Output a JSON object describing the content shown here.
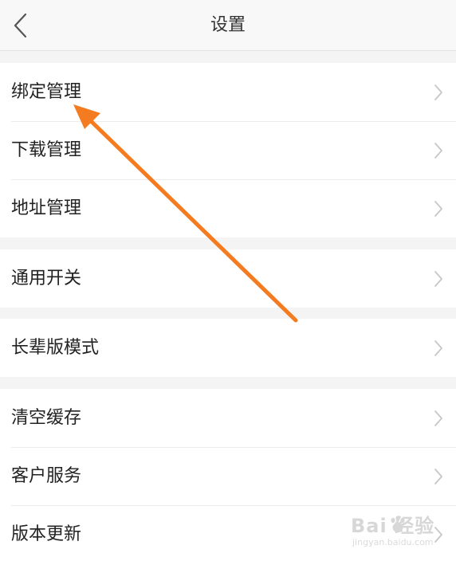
{
  "header": {
    "title": "设置",
    "back_icon": "chevron-left-icon"
  },
  "groups": [
    {
      "items": [
        {
          "label": "绑定管理"
        },
        {
          "label": "下载管理"
        },
        {
          "label": "地址管理"
        }
      ]
    },
    {
      "items": [
        {
          "label": "通用开关"
        }
      ]
    },
    {
      "items": [
        {
          "label": "长辈版模式"
        }
      ]
    },
    {
      "items": [
        {
          "label": "清空缓存"
        },
        {
          "label": "客户服务"
        },
        {
          "label": "版本更新"
        }
      ]
    }
  ],
  "annotation": {
    "arrow_color": "#f47b20",
    "points_to": "绑定管理"
  },
  "watermark": {
    "logo_text": "Bai  经验",
    "sub_text": "jingyan.baidu.com"
  },
  "colors": {
    "background": "#f4f4f4",
    "header_bg": "#f8f8f8",
    "row_bg": "#ffffff",
    "text": "#222222",
    "chevron": "#c7c7c7"
  }
}
